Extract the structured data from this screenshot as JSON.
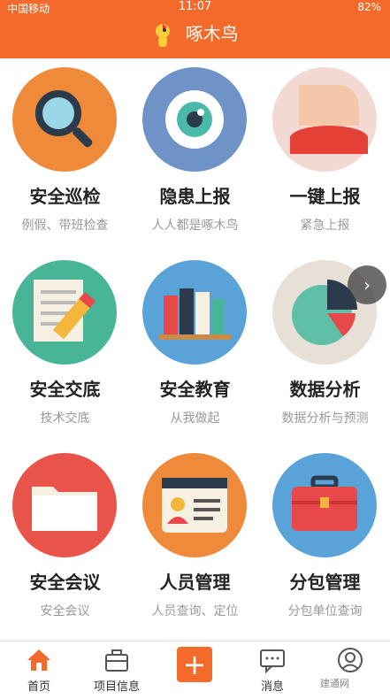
{
  "status": {
    "carrier": "中国移动",
    "time": "11:07",
    "battery": "82%"
  },
  "header": {
    "title": "啄木鸟"
  },
  "tiles": [
    {
      "title": "安全巡检",
      "sub": "例假、带班检查"
    },
    {
      "title": "隐患上报",
      "sub": "人人都是啄木鸟"
    },
    {
      "title": "一键上报",
      "sub": "紧急上报"
    },
    {
      "title": "安全交底",
      "sub": "技术交底"
    },
    {
      "title": "安全教育",
      "sub": "从我做起"
    },
    {
      "title": "数据分析",
      "sub": "数据分析与预测"
    },
    {
      "title": "安全会议",
      "sub": "安全会议"
    },
    {
      "title": "人员管理",
      "sub": "人员查询、定位"
    },
    {
      "title": "分包管理",
      "sub": "分包单位查询"
    }
  ],
  "tabbar": {
    "items": [
      {
        "label": "首页"
      },
      {
        "label": "项目信息"
      },
      {
        "label": ""
      },
      {
        "label": "消息"
      },
      {
        "label": ""
      }
    ]
  },
  "watermark": "建通网"
}
